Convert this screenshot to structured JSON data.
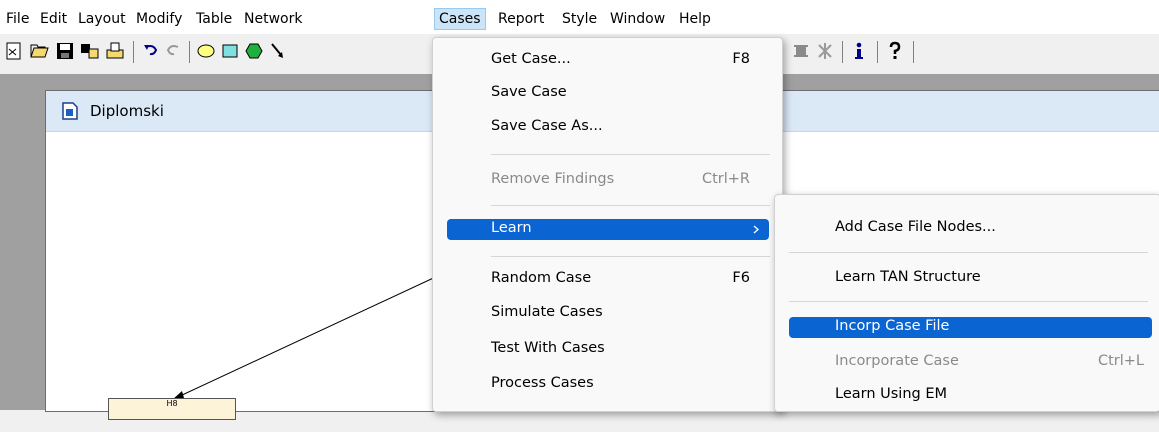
{
  "menubar": {
    "items": [
      "File",
      "Edit",
      "Layout",
      "Modify",
      "Table",
      "Network",
      "Cases",
      "Report",
      "Style",
      "Window",
      "Help"
    ]
  },
  "window": {
    "title": "Diplomski"
  },
  "canvas": {
    "nodes": [
      "H8"
    ]
  },
  "cases_menu": {
    "items": [
      {
        "label": "Get Case...",
        "shortcut": "F8"
      },
      {
        "label": "Save Case",
        "shortcut": ""
      },
      {
        "label": "Save Case As...",
        "shortcut": ""
      },
      {
        "label": "Remove Findings",
        "shortcut": "Ctrl+R"
      },
      {
        "label": "Learn",
        "shortcut": ""
      },
      {
        "label": "Random Case",
        "shortcut": "F6"
      },
      {
        "label": "Simulate Cases",
        "shortcut": ""
      },
      {
        "label": "Test With Cases",
        "shortcut": ""
      },
      {
        "label": "Process Cases",
        "shortcut": ""
      }
    ]
  },
  "learn_submenu": {
    "items": [
      {
        "label": "Add Case File Nodes...",
        "shortcut": ""
      },
      {
        "label": "Learn TAN Structure",
        "shortcut": ""
      },
      {
        "label": "Incorp Case File",
        "shortcut": ""
      },
      {
        "label": "Incorporate Case",
        "shortcut": "Ctrl+L"
      },
      {
        "label": "Learn Using EM",
        "shortcut": ""
      }
    ]
  },
  "colors": {
    "highlight": "#0a64d2",
    "disabled_text": "#8a8a8a",
    "title_bar": "#dbe9f7"
  },
  "icons": [
    "new-icon",
    "open-icon",
    "save-icon",
    "compile-icon",
    "print-icon",
    "undo-icon",
    "redo-icon",
    "ellipse-icon",
    "rectangle-icon",
    "hexagon-icon",
    "arrow-tool-icon",
    "tool-icon-1",
    "tool-icon-2",
    "info-icon",
    "help-icon"
  ]
}
